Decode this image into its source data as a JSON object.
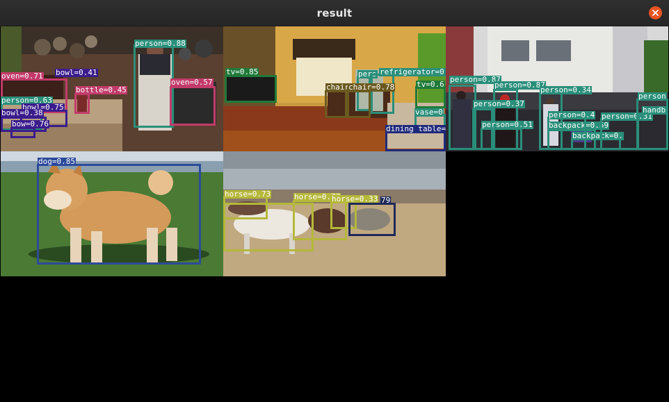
{
  "window": {
    "title": "result",
    "close_icon": "close-icon",
    "accent": "#e95420"
  },
  "panels": [
    {
      "scene": "kitchen",
      "detections": [
        {
          "label": "person=0.88",
          "color": "#2a8f7a"
        },
        {
          "label": "oven=0.71",
          "color": "#c23b6a"
        },
        {
          "label": "bowl=0.41",
          "color": "#3b1c8c"
        },
        {
          "label": "bottle=0.45",
          "color": "#c23b6a"
        },
        {
          "label": "oven=0.57",
          "color": "#c23b6a"
        },
        {
          "label": "person=0.63",
          "color": "#2a8f7a"
        },
        {
          "label": "bowl=0.75",
          "color": "#3b1c8c"
        },
        {
          "label": "bowl=0.38",
          "color": "#3b1c8c"
        },
        {
          "label": "bow=0.76",
          "color": "#3b1c8c"
        }
      ]
    },
    {
      "scene": "living-room",
      "detections": [
        {
          "label": "tv=0.85",
          "color": "#1f7a3a"
        },
        {
          "label": "pers",
          "color": "#2a8f7a"
        },
        {
          "label": "refrigerator=0.",
          "color": "#2a8f7a"
        },
        {
          "label": "chair",
          "color": "#6b5a20"
        },
        {
          "label": "chair=0.78",
          "color": "#6b5a20"
        },
        {
          "label": "tv=0.6",
          "color": "#1f7a3a"
        },
        {
          "label": "vase=0",
          "color": "#2a8f7a"
        },
        {
          "label": "dining table=0",
          "color": "#1f2a7a"
        }
      ]
    },
    {
      "scene": "street-crowd",
      "detections": [
        {
          "label": "person=0.87",
          "color": "#2a8f7a"
        },
        {
          "label": "person=0.87",
          "color": "#2a8f7a"
        },
        {
          "label": "person=0.34",
          "color": "#2a8f7a"
        },
        {
          "label": "person=0.37",
          "color": "#2a8f7a"
        },
        {
          "label": "person=0.51",
          "color": "#2a8f7a"
        },
        {
          "label": "backpack=0.59",
          "color": "#2a8f7a"
        },
        {
          "label": "person=0.4",
          "color": "#2a8f7a"
        },
        {
          "label": "backpack=0.",
          "color": "#2a8f7a"
        },
        {
          "label": "person=0.31",
          "color": "#2a8f7a"
        },
        {
          "label": "person",
          "color": "#2a8f7a"
        },
        {
          "label": "handb",
          "color": "#2a8f7a"
        }
      ]
    },
    {
      "scene": "dog-on-grass",
      "detections": [
        {
          "label": "dog=0.85",
          "color": "#2d4a9a"
        }
      ]
    },
    {
      "scene": "horses-field",
      "detections": [
        {
          "label": "horse=0.73",
          "color": "#b5b83a"
        },
        {
          "label": "horse=0.77",
          "color": "#b5b83a"
        },
        {
          "label": "horse=0.33",
          "color": "#b5b83a"
        },
        {
          "label": "79",
          "color": "#1f2a5a"
        }
      ]
    }
  ]
}
